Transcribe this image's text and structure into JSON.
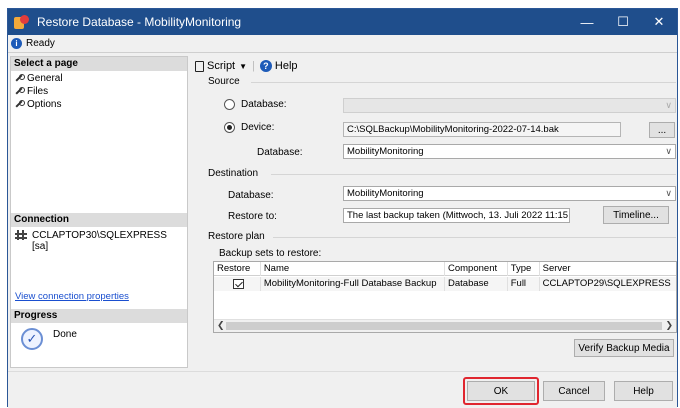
{
  "window": {
    "title": "Restore Database - MobilityMonitoring",
    "status": "Ready"
  },
  "left_pane": {
    "select_page_header": "Select a page",
    "pages": [
      {
        "label": "General"
      },
      {
        "label": "Files"
      },
      {
        "label": "Options"
      }
    ],
    "connection_header": "Connection",
    "connection_server": "CCLAPTOP30\\SQLEXPRESS",
    "connection_user": "[sa]",
    "view_connection_link": "View connection properties",
    "progress_header": "Progress",
    "progress_status": "Done"
  },
  "toolbar": {
    "script_label": "Script",
    "help_label": "Help"
  },
  "source": {
    "label": "Source",
    "database_option": "Database:",
    "device_option": "Device:",
    "device_path": "C:\\SQLBackup\\MobilityMonitoring-2022-07-14.bak",
    "browse_button": "...",
    "database_label": "Database:",
    "database_value": "MobilityMonitoring"
  },
  "destination": {
    "label": "Destination",
    "database_label": "Database:",
    "database_value": "MobilityMonitoring",
    "restore_to_label": "Restore to:",
    "restore_to_value": "The last backup taken (Mittwoch, 13. Juli 2022 11:15",
    "timeline_button": "Timeline..."
  },
  "restore_plan": {
    "label": "Restore plan",
    "backup_sets_label": "Backup sets to restore:",
    "columns": [
      "Restore",
      "Name",
      "Component",
      "Type",
      "Server"
    ],
    "rows": [
      {
        "restore": true,
        "name": "MobilityMonitoring-Full Database Backup",
        "component": "Database",
        "type": "Full",
        "server": "CCLAPTOP29\\SQLEXPRESS"
      }
    ],
    "verify_button": "Verify Backup Media"
  },
  "footer": {
    "ok_button": "OK",
    "cancel_button": "Cancel",
    "help_button": "Help"
  },
  "colors": {
    "titlebar": "#1f4e8c",
    "link": "#1a4fcf",
    "ok_highlight": "#e0262f"
  }
}
